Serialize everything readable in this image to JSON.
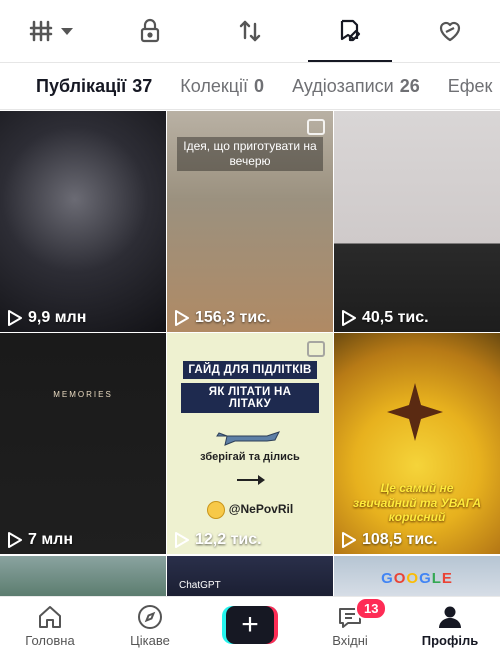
{
  "top_icons": [
    {
      "name": "grid-icon",
      "has_caret": true
    },
    {
      "name": "lock-icon"
    },
    {
      "name": "repost-icon"
    },
    {
      "name": "saved-icon",
      "active": true
    },
    {
      "name": "liked-icon"
    }
  ],
  "tabs": [
    {
      "label": "Публікації",
      "count": "37"
    },
    {
      "label": "Колекції",
      "count": "0"
    },
    {
      "label": "Аудіозаписи",
      "count": "26"
    },
    {
      "label": "Ефек",
      "count": ""
    }
  ],
  "tiles": [
    {
      "views": "9,9 млн",
      "style": "t1"
    },
    {
      "views": "156,3 тис.",
      "style": "t2",
      "caption": "Ідея, що приготувати на вечерю",
      "multi": true
    },
    {
      "views": "40,5 тис.",
      "style": "t3"
    },
    {
      "views": "7 млн",
      "style": "t4",
      "overlay": "MEMORIES"
    },
    {
      "views": "12,2 тис.",
      "style": "t5",
      "multi": true,
      "headline_1": "ГАЙД ДЛЯ ПІДЛІТКІВ",
      "headline_2": "ЯК ЛІТАТИ НА ЛІТАКУ",
      "subline": "зберігай та ділись",
      "handle": "@NePovRil"
    },
    {
      "views": "108,5 тис.",
      "style": "t6",
      "caption": "Це самий не звичайний та УВАГА корисний"
    },
    {
      "style": "t7"
    },
    {
      "style": "t8",
      "caption": "ChatGPT"
    },
    {
      "style": "t9",
      "caption": "GOOGLE"
    }
  ],
  "bottom_nav": [
    {
      "label": "Головна",
      "icon": "home-icon"
    },
    {
      "label": "Цікаве",
      "icon": "compass-icon"
    },
    {
      "label": "",
      "icon": "create-plus-icon"
    },
    {
      "label": "Вхідні",
      "icon": "inbox-icon",
      "badge": "13"
    },
    {
      "label": "Профіль",
      "icon": "profile-icon",
      "active": true
    }
  ],
  "colors": {
    "accent": "#fe2c55",
    "cyan": "#25f4ee",
    "text": "#161823"
  }
}
